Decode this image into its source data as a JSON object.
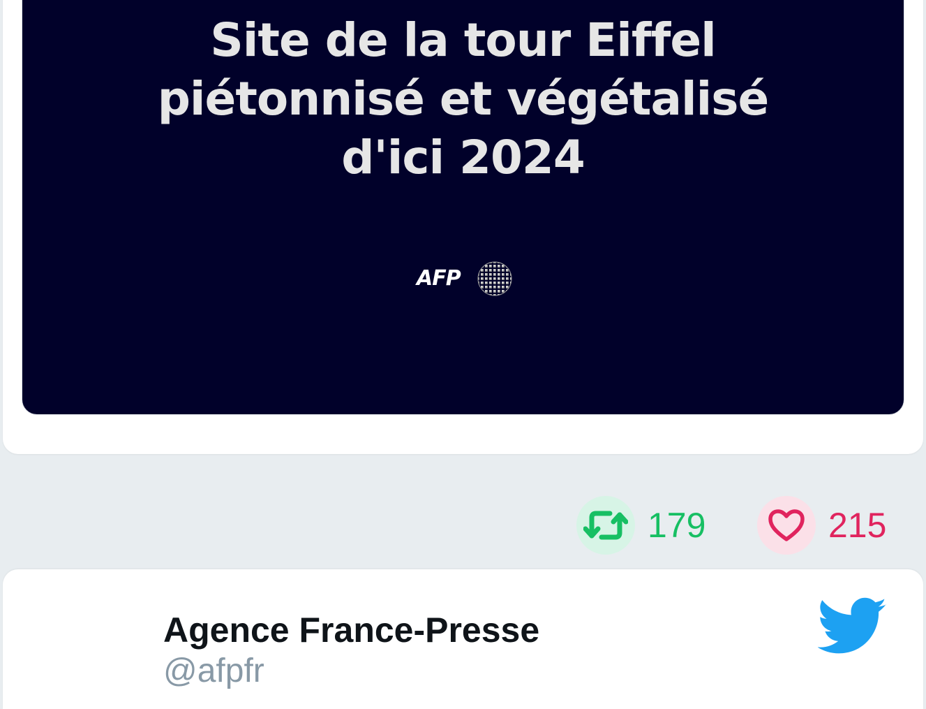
{
  "tweet_media": {
    "headline_lines": [
      "Site de la tour Eiffel",
      "piétonnisé et végétalisé",
      "d'ici 2024"
    ],
    "logo_text": "AFP",
    "background_color": "#01012a"
  },
  "engagement": {
    "retweet_icon": "retweet-icon",
    "retweet_count": "179",
    "like_icon": "heart-icon",
    "like_count": "215",
    "retweet_color": "#17bf63",
    "like_color": "#e0245e"
  },
  "next_tweet": {
    "author_name": "Agence France-Presse",
    "author_handle": "@afpfr",
    "platform_icon": "twitter-bird-icon",
    "platform_color": "#1da1f2"
  }
}
